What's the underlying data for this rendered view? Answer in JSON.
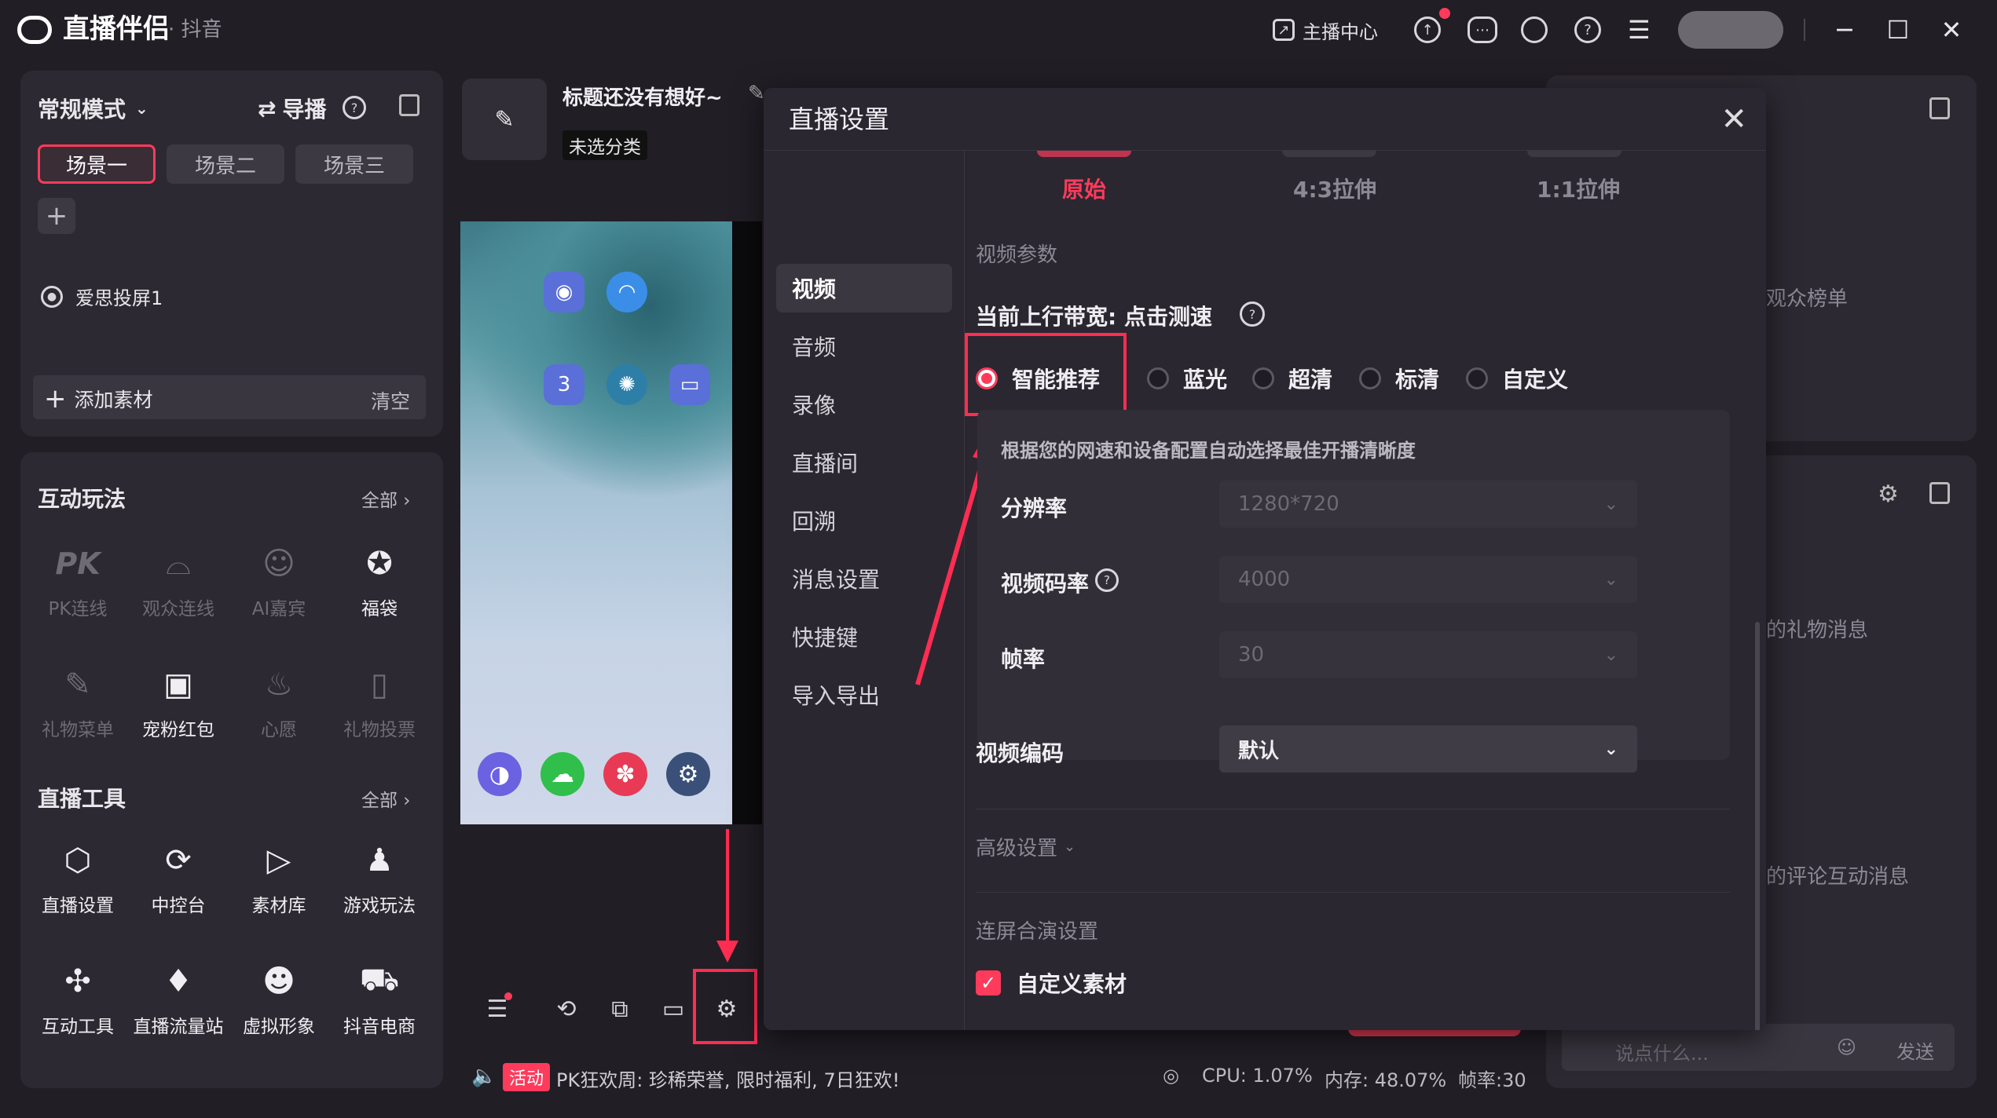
{
  "app": {
    "title": "直播伴侣",
    "subtitle": "· 抖音"
  },
  "titlebar": {
    "host_center": "主播中心"
  },
  "left": {
    "mode": "常规模式",
    "guide": "导播",
    "scenes": [
      "场景一",
      "场景二",
      "场景三"
    ],
    "source": "爱思投屏1",
    "add_material": "添加素材",
    "clear": "清空",
    "interact": {
      "title": "互动玩法",
      "all": "全部",
      "items": [
        {
          "label": "PK连线",
          "icon": "pk-icon",
          "enabled": false
        },
        {
          "label": "观众连线",
          "icon": "audience-link-icon",
          "enabled": false
        },
        {
          "label": "AI嘉宾",
          "icon": "ai-guest-icon",
          "enabled": false
        },
        {
          "label": "福袋",
          "icon": "lucky-bag-icon",
          "enabled": true
        },
        {
          "label": "礼物菜单",
          "icon": "gift-menu-icon",
          "enabled": false
        },
        {
          "label": "宠粉红包",
          "icon": "red-packet-icon",
          "enabled": true
        },
        {
          "label": "心愿",
          "icon": "wish-icon",
          "enabled": false
        },
        {
          "label": "礼物投票",
          "icon": "gift-vote-icon",
          "enabled": false
        }
      ]
    },
    "tools": {
      "title": "直播工具",
      "all": "全部",
      "items": [
        {
          "label": "直播设置",
          "icon": "live-settings-icon"
        },
        {
          "label": "中控台",
          "icon": "console-icon"
        },
        {
          "label": "素材库",
          "icon": "material-library-icon"
        },
        {
          "label": "游戏玩法",
          "icon": "game-icon"
        },
        {
          "label": "互动工具",
          "icon": "puzzle-icon"
        },
        {
          "label": "直播流量站",
          "icon": "traffic-icon"
        },
        {
          "label": "虚拟形象",
          "icon": "avatar-icon"
        },
        {
          "label": "抖音电商",
          "icon": "cart-icon"
        }
      ]
    }
  },
  "stream": {
    "title": "标题还没有想好~",
    "category": "未选分类"
  },
  "status": {
    "activity_badge": "活动",
    "activity_text": "PK狂欢周: 珍稀荣誉, 限时福利, 7日狂欢!",
    "cpu": "CPU: 1.07%",
    "memory": "内存: 48.07%",
    "fps": "帧率:30"
  },
  "right": {
    "audience_rank": "观众榜单",
    "gift_msg": "的礼物消息",
    "comment_msg": "的评论互动消息",
    "chat_placeholder": "说点什么...",
    "send": "发送"
  },
  "modal": {
    "title": "直播设置",
    "nav": [
      "视频",
      "音频",
      "录像",
      "直播间",
      "回溯",
      "消息设置",
      "快捷键",
      "导入导出"
    ],
    "tabs": [
      "原始",
      "4:3拉伸",
      "1:1拉伸"
    ],
    "video_params": "视频参数",
    "bandwidth_label": "当前上行带宽: 点击测速",
    "quality_options": [
      "智能推荐",
      "蓝光",
      "超清",
      "标清",
      "自定义"
    ],
    "quality_selected": "智能推荐",
    "auto_hint": "根据您的网速和设备配置自动选择最佳开播清晰度",
    "resolution_label": "分辨率",
    "resolution_value": "1280*720",
    "bitrate_label": "视频码率",
    "bitrate_value": "4000",
    "fps_label": "帧率",
    "fps_value": "30",
    "encoder_label": "视频编码",
    "encoder_value": "默认",
    "advanced": "高级设置",
    "multi_screen": "连屏合演设置",
    "custom_material": "自定义素材",
    "custom_material_checked": true
  },
  "colors": {
    "accent": "#ff3b5c",
    "bg": "#221e26",
    "panel": "#2d2932"
  }
}
